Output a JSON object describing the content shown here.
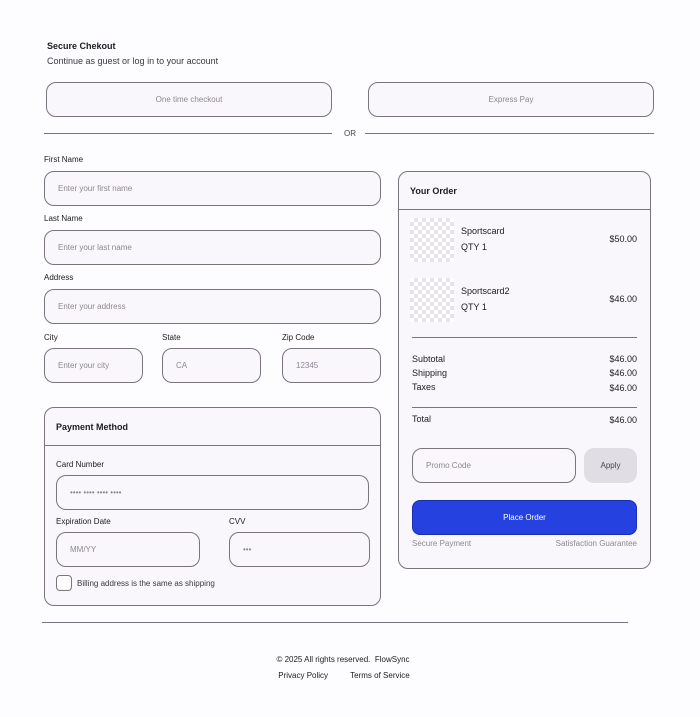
{
  "header": {
    "title": "Secure Chekout",
    "subtitle": "Continue as guest or log in to your account"
  },
  "checkout_options": {
    "one_time": "One time checkout",
    "express": "Express Pay",
    "divider": "OR"
  },
  "form": {
    "first_name": {
      "label": "First Name",
      "placeholder": "Enter your first name"
    },
    "last_name": {
      "label": "Last Name",
      "placeholder": "Enter your last name"
    },
    "address": {
      "label": "Address",
      "placeholder": "Enter your address"
    },
    "city": {
      "label": "City",
      "placeholder": "Enter your city"
    },
    "state": {
      "label": "State",
      "placeholder": "CA"
    },
    "zip": {
      "label": "Zip Code",
      "placeholder": "12345"
    }
  },
  "payment": {
    "title": "Payment Method",
    "card_number": {
      "label": "Card Number",
      "placeholder": "•••• •••• •••• ••••"
    },
    "expiration": {
      "label": "Expiration Date",
      "placeholder": "MM/YY"
    },
    "cvv": {
      "label": "CVV",
      "placeholder": "•••"
    },
    "billing_same": "Billing address is the same as shipping"
  },
  "order": {
    "title": "Your Order",
    "items": [
      {
        "name": "Sportscard",
        "qty": "QTY 1",
        "price": "$50.00"
      },
      {
        "name": "Sportscard2",
        "qty": "QTY 1",
        "price": "$46.00"
      }
    ],
    "subtotal_label": "Subtotal",
    "subtotal": "$46.00",
    "shipping_label": "Shipping",
    "shipping": "$46.00",
    "taxes_label": "Taxes",
    "taxes": "$46.00",
    "total_label": "Total",
    "total": "$46.00",
    "promo_placeholder": "Promo Code",
    "apply_label": "Apply",
    "place_order_label": "Place Order",
    "secure_payment": "Secure Payment",
    "satisfaction": "Satisfaction Guarantee"
  },
  "footer": {
    "copyright": "© 2025 All rights reserved.",
    "brand": "FlowSync",
    "privacy": "Privacy Policy",
    "terms": "Terms of Service"
  },
  "colors": {
    "accent": "#2541e0",
    "border": "#79747e",
    "surface": "#faf7fc"
  }
}
